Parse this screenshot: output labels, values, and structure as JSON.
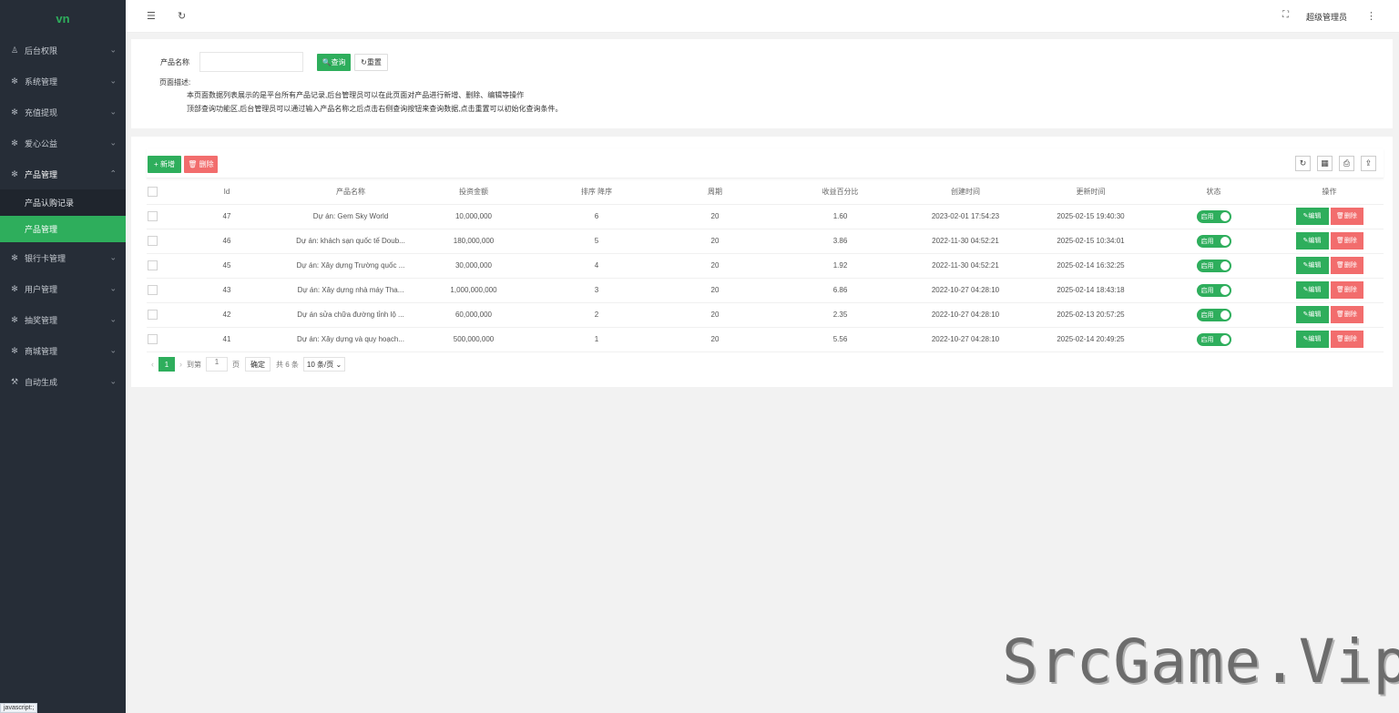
{
  "sidebar": {
    "logo": "vn",
    "items": [
      {
        "label": "后台权限",
        "icon": "user-icon",
        "glyph": "♙",
        "arrow": "⌄"
      },
      {
        "label": "系统管理",
        "icon": "gear-icon",
        "glyph": "✻",
        "arrow": "⌄"
      },
      {
        "label": "充值提现",
        "icon": "gear-icon",
        "glyph": "✻",
        "arrow": "⌄"
      },
      {
        "label": "爱心公益",
        "icon": "gear-icon",
        "glyph": "✻",
        "arrow": "⌄"
      },
      {
        "label": "产品管理",
        "icon": "gear-icon",
        "glyph": "✻",
        "arrow": "⌃"
      },
      {
        "label": "银行卡管理",
        "icon": "gear-icon",
        "glyph": "✻",
        "arrow": "⌄"
      },
      {
        "label": "用户管理",
        "icon": "gear-icon",
        "glyph": "✻",
        "arrow": "⌄"
      },
      {
        "label": "抽奖管理",
        "icon": "gear-icon",
        "glyph": "✻",
        "arrow": "⌄"
      },
      {
        "label": "商城管理",
        "icon": "gear-icon",
        "glyph": "✻",
        "arrow": "⌄"
      },
      {
        "label": "自动生成",
        "icon": "wand-icon",
        "glyph": "⚒",
        "arrow": "⌄"
      }
    ],
    "sub_items": [
      {
        "label": "产品认购记录"
      },
      {
        "label": "产品管理"
      }
    ]
  },
  "header": {
    "menu_glyph": "☰",
    "refresh_glyph": "↻",
    "fullscreen_glyph": "⛶",
    "more_glyph": "⋮",
    "user": "超级管理员"
  },
  "search": {
    "label": "产品名称",
    "value": "",
    "placeholder": "",
    "search_btn": "🔍查询",
    "reset_btn": "↻重置",
    "desc_title": "页面描述:",
    "desc_1": "本页面数据列表展示的是平台所有产品记录,后台管理员可以在此页面对产品进行新增、删除、编辑等操作",
    "desc_2": "顶部查询功能区,后台管理员可以通过输入产品名称之后点击右侧查询按钮来查询数据,点击重置可以初始化查询条件。"
  },
  "toolbar": {
    "add_label": "+ 新增",
    "del_label": "🗑 删除",
    "tools": [
      {
        "name": "refresh-icon",
        "glyph": "↻"
      },
      {
        "name": "columns-icon",
        "glyph": "▦"
      },
      {
        "name": "print-icon",
        "glyph": "⎙"
      },
      {
        "name": "export-icon",
        "glyph": "⇪"
      }
    ]
  },
  "table": {
    "columns": [
      "Id",
      "产品名称",
      "投资金额",
      "排序 降序",
      "周期",
      "收益百分比",
      "创建时间",
      "更新时间",
      "状态",
      "操作"
    ],
    "rows": [
      {
        "id": "47",
        "name": "Dự án: Gem Sky World",
        "amount": "10,000,000",
        "sort": "6",
        "period": "20",
        "rate": "1.60",
        "created": "2023-02-01 17:54:23",
        "updated": "2025-02-15 19:40:30",
        "status": "启用",
        "edit": "✎编辑",
        "del": "🗑删除"
      },
      {
        "id": "46",
        "name": "Dự án: khách sạn quốc tế Doub...",
        "amount": "180,000,000",
        "sort": "5",
        "period": "20",
        "rate": "3.86",
        "created": "2022-11-30 04:52:21",
        "updated": "2025-02-15 10:34:01",
        "status": "启用",
        "edit": "✎编辑",
        "del": "🗑删除"
      },
      {
        "id": "45",
        "name": "Dự án: Xây dựng Trường quốc ...",
        "amount": "30,000,000",
        "sort": "4",
        "period": "20",
        "rate": "1.92",
        "created": "2022-11-30 04:52:21",
        "updated": "2025-02-14 16:32:25",
        "status": "启用",
        "edit": "✎编辑",
        "del": "🗑删除"
      },
      {
        "id": "43",
        "name": "Dự án: Xây dựng nhà máy Tha...",
        "amount": "1,000,000,000",
        "sort": "3",
        "period": "20",
        "rate": "6.86",
        "created": "2022-10-27 04:28:10",
        "updated": "2025-02-14 18:43:18",
        "status": "启用",
        "edit": "✎编辑",
        "del": "🗑删除"
      },
      {
        "id": "42",
        "name": "Dự án sửa chữa đường tỉnh lộ ...",
        "amount": "60,000,000",
        "sort": "2",
        "period": "20",
        "rate": "2.35",
        "created": "2022-10-27 04:28:10",
        "updated": "2025-02-13 20:57:25",
        "status": "启用",
        "edit": "✎编辑",
        "del": "🗑删除"
      },
      {
        "id": "41",
        "name": "Dự án: Xây dựng và quy hoạch...",
        "amount": "500,000,000",
        "sort": "1",
        "period": "20",
        "rate": "5.56",
        "created": "2022-10-27 04:28:10",
        "updated": "2025-02-14 20:49:25",
        "status": "启用",
        "edit": "✎编辑",
        "del": "🗑删除"
      }
    ]
  },
  "pager": {
    "prev": "‹",
    "current": "1",
    "next": "›",
    "goto_label": "到第",
    "goto_value": "1",
    "page_unit": "页",
    "ok": "确定",
    "total": "共 6 条",
    "per_page": "10 条/页 ⌄"
  },
  "status_bar": "javascript:;",
  "watermark": "SrcGame.Vip"
}
